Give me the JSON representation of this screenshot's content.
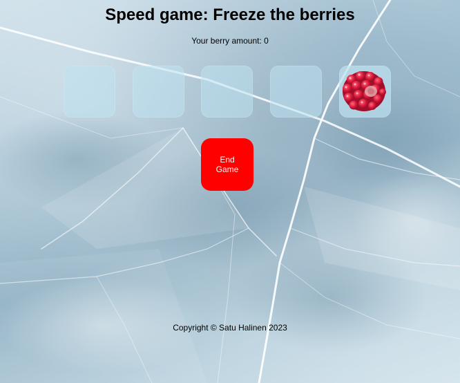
{
  "header": {
    "title": "Speed game: Freeze the berries"
  },
  "score": {
    "text": "Your berry amount: 0"
  },
  "circles": [
    {
      "label": "circle-1",
      "has_berry": false
    },
    {
      "label": "circle-2",
      "has_berry": false
    },
    {
      "label": "circle-3",
      "has_berry": false
    },
    {
      "label": "circle-4",
      "has_berry": false
    },
    {
      "label": "circle-5",
      "has_berry": true
    }
  ],
  "controls": {
    "end_label": "End Game",
    "end_color": "#ff0000"
  },
  "footer": {
    "text": "Copyright © Satu Halinen 2023"
  },
  "icons": {
    "berry": "raspberry-icon"
  },
  "colors": {
    "ice_light": "#d2e3ec",
    "ice_dark": "#8fb0c3"
  }
}
